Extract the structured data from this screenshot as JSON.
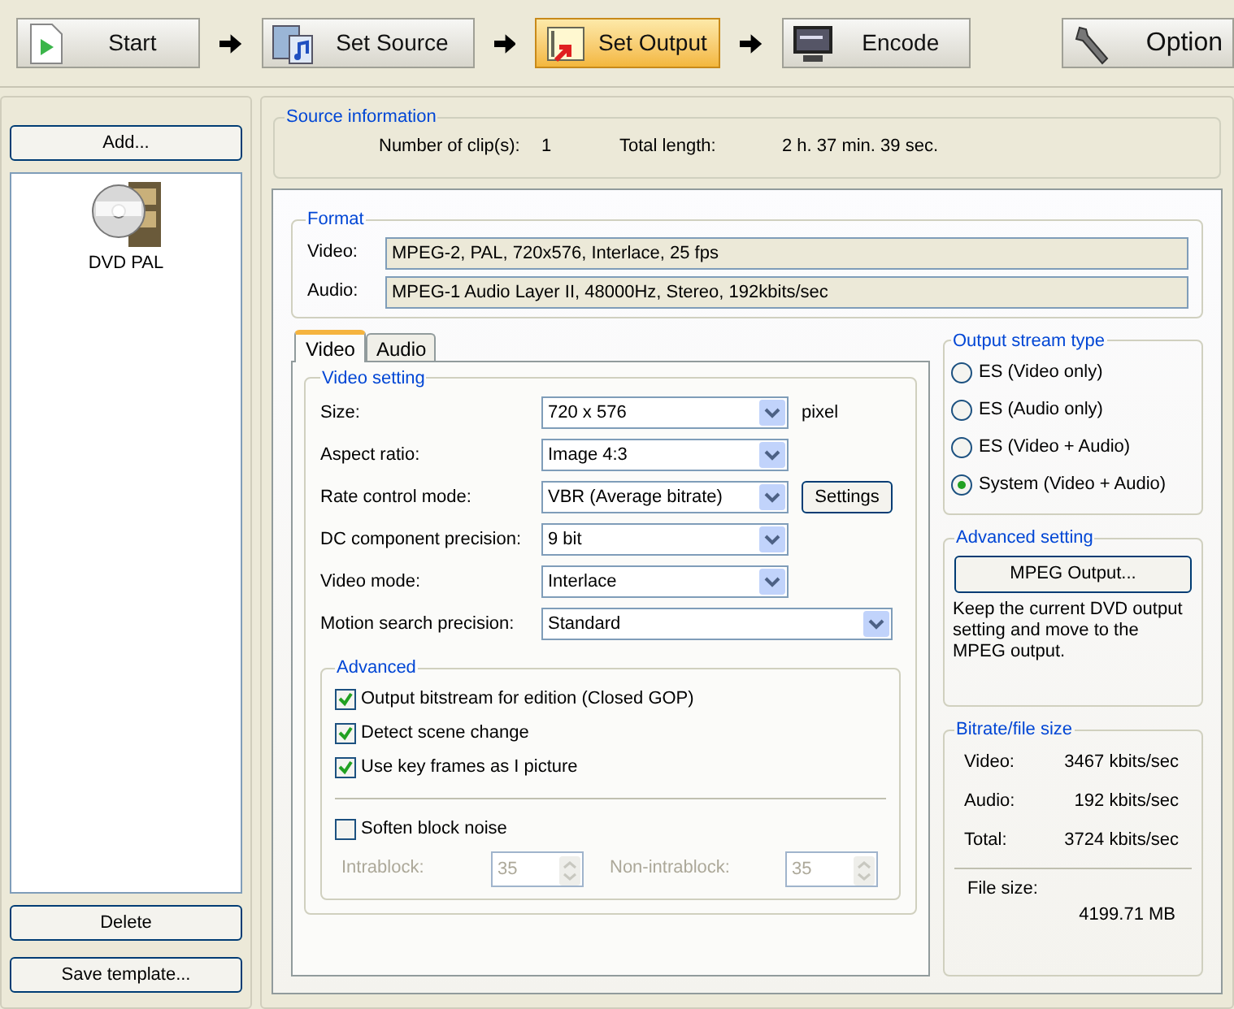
{
  "steps": [
    {
      "kind": "start",
      "label": "Start",
      "selected": false
    },
    {
      "kind": "source",
      "label": "Set Source",
      "selected": false
    },
    {
      "kind": "output",
      "label": "Set Output",
      "selected": true
    },
    {
      "kind": "encode",
      "label": "Encode",
      "selected": false
    }
  ],
  "option_button": "Option",
  "sidebar": {
    "add_button": "Add...",
    "items": [
      {
        "label": "DVD PAL",
        "selected": false
      }
    ],
    "delete_button": "Delete",
    "save_template_button": "Save template..."
  },
  "source_information": {
    "title": "Source information",
    "fields": [
      {
        "label": "Number of clip(s):",
        "value": "1"
      },
      {
        "label": "Total length:",
        "value": "2 h. 37 min. 39 sec."
      }
    ]
  },
  "format": {
    "title": "Format",
    "rows": [
      {
        "label": "Video:",
        "value": "MPEG-2, PAL, 720x576, Interlace, 25 fps"
      },
      {
        "label": "Audio:",
        "value": "MPEG-1 Audio Layer II, 48000Hz, Stereo, 192kbits/sec"
      }
    ]
  },
  "tabs": [
    {
      "label": "Video",
      "selected": true
    },
    {
      "label": "Audio",
      "selected": false
    }
  ],
  "video_setting": {
    "title": "Video setting",
    "rows": [
      {
        "label": "Size:",
        "value": "720 x 576",
        "unit": "pixel",
        "wide": false
      },
      {
        "label": "Aspect ratio:",
        "value": "Image 4:3",
        "wide": false
      },
      {
        "label": "Rate control mode:",
        "value": "VBR (Average bitrate)",
        "button": "Settings",
        "wide": false
      },
      {
        "label": "DC component precision:",
        "value": "9 bit",
        "wide": false
      },
      {
        "label": "Video mode:",
        "value": "Interlace",
        "wide": false
      },
      {
        "label": "Motion search precision:",
        "value": "Standard",
        "wide": true
      }
    ]
  },
  "advanced": {
    "title": "Advanced",
    "checkboxes": [
      {
        "label": "Output bitstream for edition (Closed GOP)",
        "checked": true
      },
      {
        "label": "Detect scene change",
        "checked": true
      },
      {
        "label": "Use key frames as I picture",
        "checked": true
      }
    ],
    "soften": {
      "label": "Soften block noise",
      "checked": false
    },
    "spinners": [
      {
        "label": "Intrablock:",
        "value": "35",
        "disabled": true
      },
      {
        "label": "Non-intrablock:",
        "value": "35",
        "disabled": true
      }
    ]
  },
  "output_stream_type": {
    "title": "Output stream type",
    "options": [
      {
        "label": "ES (Video only)",
        "selected": false
      },
      {
        "label": "ES (Audio only)",
        "selected": false
      },
      {
        "label": "ES (Video + Audio)",
        "selected": false
      },
      {
        "label": "System (Video + Audio)",
        "selected": true
      }
    ]
  },
  "advanced_setting": {
    "title": "Advanced setting",
    "button": "MPEG Output...",
    "description": "Keep the current DVD output setting and move to the MPEG output."
  },
  "bitrate": {
    "title": "Bitrate/file size",
    "rows": [
      {
        "label": "Video:",
        "value": "3467 kbits/sec"
      },
      {
        "label": "Audio:",
        "value": "192 kbits/sec"
      },
      {
        "label": "Total:",
        "value": "3724 kbits/sec"
      }
    ],
    "file_size": {
      "label": "File size:",
      "value": "4199.71 MB"
    }
  }
}
